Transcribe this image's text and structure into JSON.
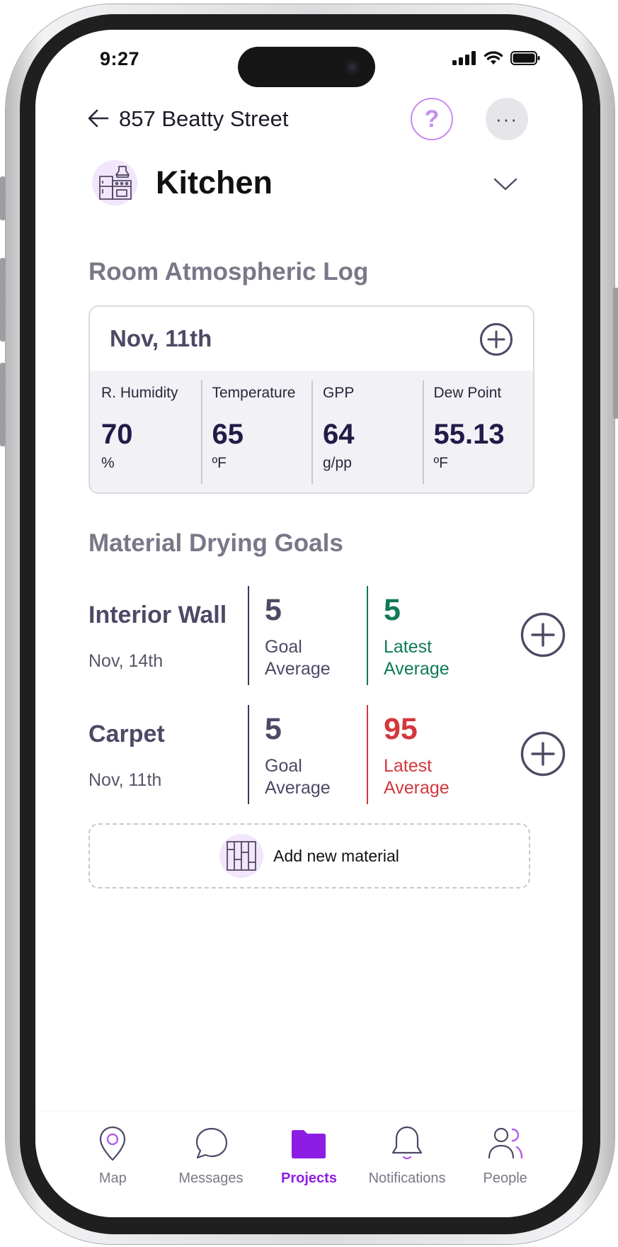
{
  "status_bar": {
    "time": "9:27"
  },
  "header": {
    "back_label": "←",
    "address": "857 Beatty Street",
    "help_label": "?",
    "more_label": "···"
  },
  "room": {
    "name": "Kitchen"
  },
  "atmospheric_log": {
    "title": "Room Atmospheric Log",
    "date": "Nov, 11th",
    "metrics": [
      {
        "label": "R. Humidity",
        "value": "70",
        "unit": "%"
      },
      {
        "label": "Temperature",
        "value": "65",
        "unit": "ºF"
      },
      {
        "label": "GPP",
        "value": "64",
        "unit": "g/pp"
      },
      {
        "label": "Dew Point",
        "value": "55.13",
        "unit": "ºF"
      }
    ]
  },
  "drying_goals": {
    "title": "Material Drying Goals",
    "materials": [
      {
        "name": "Interior Wall",
        "date": "Nov, 14th",
        "goal_value": "5",
        "goal_caption_1": "Goal",
        "goal_caption_2": "Average",
        "latest_value": "5",
        "latest_caption_1": "Latest",
        "latest_caption_2": "Average",
        "status": "on-target",
        "status_color": "#0f7a55"
      },
      {
        "name": "Carpet",
        "date": "Nov, 11th",
        "goal_value": "5",
        "goal_caption_1": "Goal",
        "goal_caption_2": "Average",
        "latest_value": "95",
        "latest_caption_1": "Latest",
        "latest_caption_2": "Average",
        "status": "above-goal",
        "status_color": "#d3383d"
      }
    ],
    "add_material_label": "Add new material"
  },
  "tab_bar": {
    "items": [
      {
        "label": "Map",
        "icon": "map-pin-icon",
        "active": false
      },
      {
        "label": "Messages",
        "icon": "chat-bubble-icon",
        "active": false
      },
      {
        "label": "Projects",
        "icon": "folder-icon",
        "active": true
      },
      {
        "label": "Notifications",
        "icon": "bell-icon",
        "active": false
      },
      {
        "label": "People",
        "icon": "people-icon",
        "active": false
      }
    ]
  },
  "colors": {
    "accent": "#8d1de3",
    "accent_light": "#c58df0",
    "primary_text": "#4f4865",
    "ok": "#0f7a55",
    "alert": "#d3383d"
  }
}
